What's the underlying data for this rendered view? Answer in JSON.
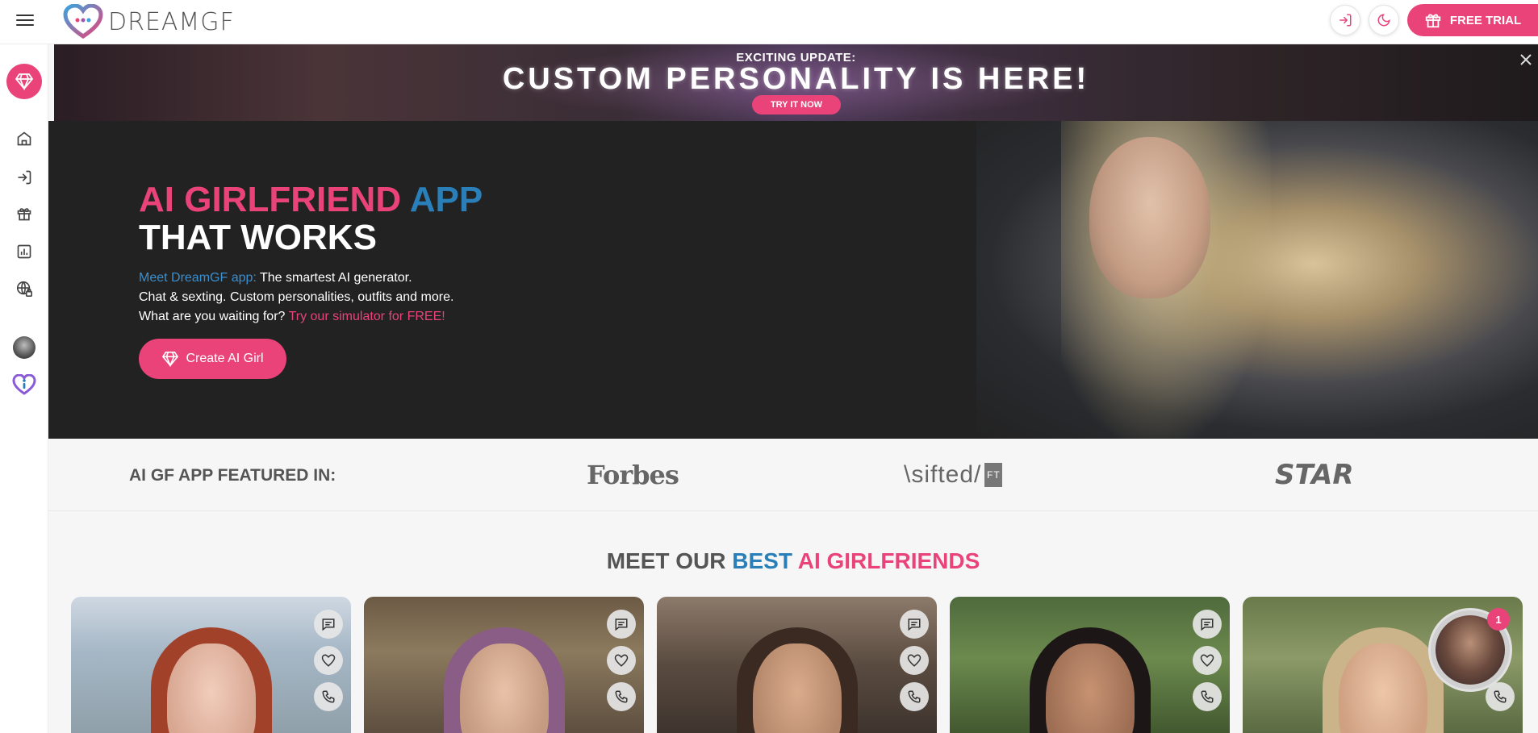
{
  "header": {
    "logo_text": "DREAMGF",
    "free_trial_label": "FREE TRIAL",
    "icons": [
      "menu-icon",
      "login-icon",
      "moon-icon",
      "gift-icon"
    ]
  },
  "sidebar": {
    "items": [
      "diamond-icon",
      "home-icon",
      "login-icon",
      "gift-icon",
      "chart-icon",
      "globe-lock-icon",
      "avatar",
      "info-heart-icon"
    ]
  },
  "banner": {
    "kicker": "EXCITING UPDATE:",
    "title": "CUSTOM PERSONALITY IS HERE!",
    "cta": "TRY IT NOW"
  },
  "hero": {
    "title_part1": "AI GIRLFRIEND",
    "title_part2": "APP",
    "title_line2": "THAT WORKS",
    "desc_line1_lead": "Meet DreamGF app:",
    "desc_line1_rest": " The smartest AI generator.",
    "desc_line2": "Chat & sexting. Custom personalities, outfits and more.",
    "desc_line3_lead": "What are you waiting for?",
    "desc_line3_link": " Try our simulator for FREE!",
    "cta": "Create AI Girl"
  },
  "featured": {
    "label": "AI GF APP FEATURED IN:",
    "press": [
      "Forbes",
      "\\sifted/",
      "FT",
      "STAR"
    ]
  },
  "section": {
    "title_part1": "MEET OUR",
    "title_part2": "BEST",
    "title_part3": "AI GIRLFRIENDS"
  },
  "cards": [
    {
      "name": "card-1"
    },
    {
      "name": "card-2"
    },
    {
      "name": "card-3"
    },
    {
      "name": "card-4"
    },
    {
      "name": "card-5"
    }
  ],
  "chat_widget": {
    "badge_count": "1"
  },
  "colors": {
    "accent_pink": "#e9437a",
    "accent_blue": "#2a7fb8",
    "hero_bg": "#222222"
  }
}
